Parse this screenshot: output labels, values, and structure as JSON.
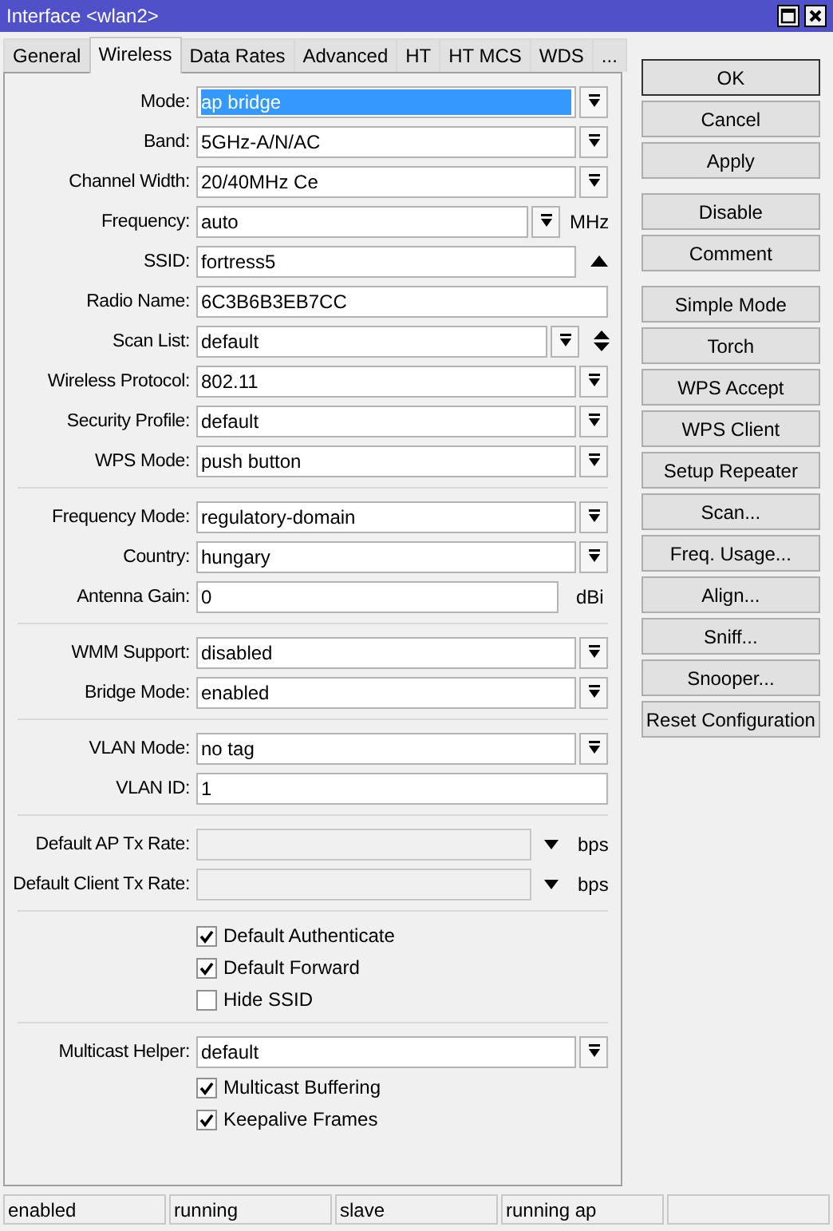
{
  "window": {
    "title": "Interface <wlan2>"
  },
  "tabs": [
    {
      "label": "General",
      "selected": false
    },
    {
      "label": "Wireless",
      "selected": true
    },
    {
      "label": "Data Rates",
      "selected": false
    },
    {
      "label": "Advanced",
      "selected": false
    },
    {
      "label": "HT",
      "selected": false
    },
    {
      "label": "HT MCS",
      "selected": false
    },
    {
      "label": "WDS",
      "selected": false
    },
    {
      "label": "...",
      "selected": false
    }
  ],
  "sections": [
    {
      "rows": [
        {
          "kind": "dropdown",
          "label": "Mode:",
          "value": "ap bridge",
          "highlighted": true
        },
        {
          "kind": "dropdown",
          "label": "Band:",
          "value": "5GHz-A/N/AC",
          "highlighted": false
        },
        {
          "kind": "dropdown",
          "label": "Channel Width:",
          "value": "20/40MHz Ce",
          "highlighted": false
        },
        {
          "kind": "dropdown-unit",
          "label": "Frequency:",
          "value": "auto",
          "unit": "MHz",
          "highlighted": false
        },
        {
          "kind": "text-collapse",
          "label": "SSID:",
          "value": "fortress5",
          "highlighted": false
        },
        {
          "kind": "text",
          "label": "Radio Name:",
          "value": "6C3B6B3EB7CC",
          "highlighted": false
        },
        {
          "kind": "dropdown-updown",
          "label": "Scan List:",
          "value": "default",
          "highlighted": false
        },
        {
          "kind": "dropdown",
          "label": "Wireless Protocol:",
          "value": "802.11",
          "highlighted": false
        },
        {
          "kind": "dropdown",
          "label": "Security Profile:",
          "value": "default",
          "highlighted": false
        },
        {
          "kind": "dropdown",
          "label": "WPS Mode:",
          "value": "push button",
          "highlighted": false
        }
      ]
    },
    {
      "rows": [
        {
          "kind": "dropdown",
          "label": "Frequency Mode:",
          "value": "regulatory-domain",
          "highlighted": false
        },
        {
          "kind": "dropdown",
          "label": "Country:",
          "value": "hungary",
          "highlighted": false
        },
        {
          "kind": "text-unit",
          "label": "Antenna Gain:",
          "value": "0",
          "unit": "dBi",
          "highlighted": false
        }
      ]
    },
    {
      "rows": [
        {
          "kind": "dropdown",
          "label": "WMM Support:",
          "value": "disabled",
          "highlighted": false
        },
        {
          "kind": "dropdown",
          "label": "Bridge Mode:",
          "value": "enabled",
          "highlighted": false
        }
      ]
    },
    {
      "rows": [
        {
          "kind": "dropdown",
          "label": "VLAN Mode:",
          "value": "no tag",
          "highlighted": false
        },
        {
          "kind": "text",
          "label": "VLAN ID:",
          "value": "1",
          "highlighted": false
        }
      ]
    },
    {
      "rows": [
        {
          "kind": "rate",
          "label": "Default AP Tx Rate:",
          "unit": "bps",
          "disabled": true
        },
        {
          "kind": "rate",
          "label": "Default Client Tx Rate:",
          "unit": "bps",
          "disabled": true
        }
      ]
    },
    {
      "rows": [
        {
          "kind": "checkbox",
          "label": "Default Authenticate",
          "checked": true
        },
        {
          "kind": "checkbox",
          "label": "Default Forward",
          "checked": true
        },
        {
          "kind": "checkbox",
          "label": "Hide SSID",
          "checked": false
        }
      ]
    },
    {
      "rows": [
        {
          "kind": "dropdown",
          "label": "Multicast Helper:",
          "value": "default",
          "highlighted": false
        },
        {
          "kind": "checkbox",
          "label": "Multicast Buffering",
          "checked": true
        },
        {
          "kind": "checkbox",
          "label": "Keepalive Frames",
          "checked": true
        }
      ]
    }
  ],
  "button_groups": [
    [
      "OK",
      "Cancel",
      "Apply"
    ],
    [
      "Disable",
      "Comment"
    ],
    [
      "Simple Mode",
      "Torch",
      "WPS Accept",
      "WPS Client",
      "Setup Repeater",
      "Scan...",
      "Freq. Usage...",
      "Align...",
      "Sniff...",
      "Snooper...",
      "Reset Configuration"
    ]
  ],
  "status_bar": [
    "enabled",
    "running",
    "slave",
    "running ap"
  ]
}
